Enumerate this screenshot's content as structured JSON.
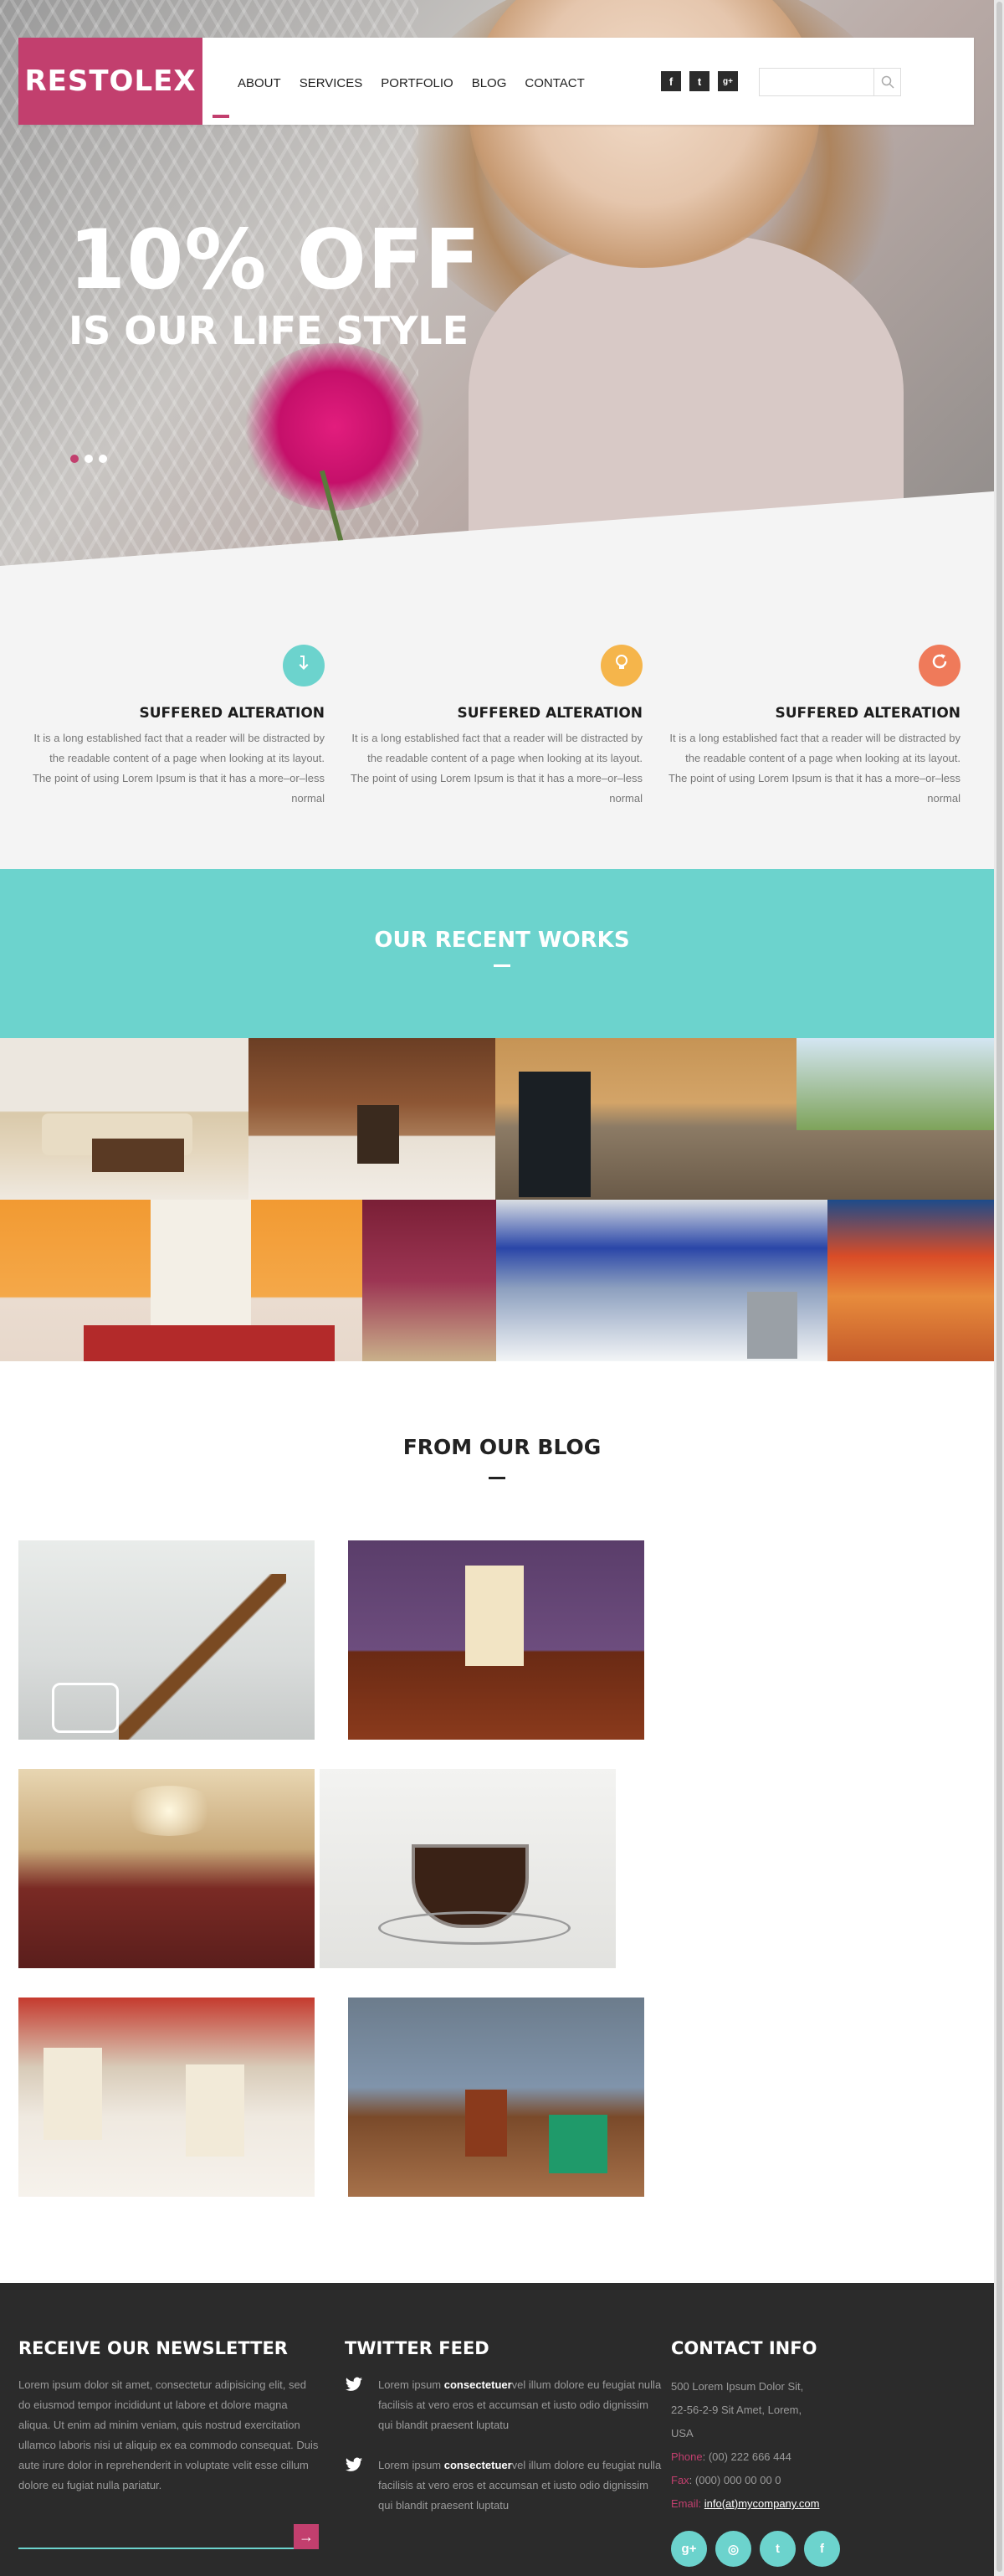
{
  "header": {
    "logo": "RESTOLEX",
    "nav": [
      "ABOUT",
      "SERVICES",
      "PORTFOLIO",
      "BLOG",
      "CONTACT"
    ],
    "social": [
      {
        "icon": "facebook-icon",
        "glyph": "f"
      },
      {
        "icon": "twitter-icon",
        "glyph": "t"
      },
      {
        "icon": "google-plus-icon",
        "glyph": "g+"
      }
    ],
    "search": {
      "placeholder": "",
      "icon": "search-icon"
    }
  },
  "hero": {
    "headline": "10% OFF",
    "subheadline": "IS OUR LIFE STYLE",
    "slides": 3,
    "active_slide": 1
  },
  "features": [
    {
      "icon": "arrow-down-icon",
      "color": "#6cd3cd",
      "title": "SUFFERED ALTERATION",
      "text": "It is a long established fact that a reader will be distracted by the readable content of a page when looking at its layout. The point of using Lorem Ipsum is that it has a more–or–less normal"
    },
    {
      "icon": "lightbulb-icon",
      "color": "#f5b54b",
      "title": "SUFFERED ALTERATION",
      "text": "It is a long established fact that a reader will be distracted by the readable content of a page when looking at its layout. The point of using Lorem Ipsum is that it has a more–or–less normal"
    },
    {
      "icon": "refresh-icon",
      "color": "#ef7a5a",
      "title": "SUFFERED ALTERATION",
      "text": "It is a long established fact that a reader will be distracted by the readable content of a page when looking at its layout. The point of using Lorem Ipsum is that it has a more–or–less normal"
    }
  ],
  "works": {
    "title": "OUR RECENT WORKS"
  },
  "blog": {
    "title": "FROM OUR BLOG"
  },
  "footer": {
    "newsletter": {
      "title": "RECEIVE OUR NEWSLETTER",
      "text": "Lorem ipsum dolor sit amet, consectetur adipisicing elit, sed do eiusmod tempor incididunt ut labore et dolore magna aliqua. Ut enim ad minim veniam, quis nostrud exercitation ullamco laboris nisi ut aliquip ex ea commodo consequat. Duis aute irure dolor in reprehenderit in voluptate velit esse cillum dolore eu fugiat nulla pariatur."
    },
    "twitter": {
      "title": "TWITTER FEED",
      "tweets": [
        {
          "pre": "Lorem ipsum ",
          "bold": "consectetuer",
          "post": "vel illum dolore eu feugiat nulla facilisis at vero eros et accumsan et iusto odio dignissim qui blandit praesent luptatu"
        },
        {
          "pre": "Lorem ipsum ",
          "bold": "consectetuer",
          "post": "vel illum dolore eu feugiat nulla facilisis at vero eros et accumsan et iusto odio dignissim qui blandit praesent luptatu"
        }
      ]
    },
    "contact": {
      "title": "CONTACT INFO",
      "address": [
        "500 Lorem Ipsum Dolor Sit,",
        "22-56-2-9 Sit Amet, Lorem,",
        "USA"
      ],
      "phone_label": "Phone",
      "phone": ": (00) 222 666 444",
      "fax_label": "Fax",
      "fax": ": (000) 000 00 00 0",
      "email_label": "Email",
      "email_sep": ": ",
      "email": "info(at)mycompany.com",
      "social": [
        {
          "icon": "google-plus-icon",
          "glyph": "g+"
        },
        {
          "icon": "dribbble-icon",
          "glyph": "◎"
        },
        {
          "icon": "twitter-icon",
          "glyph": "t"
        },
        {
          "icon": "facebook-icon",
          "glyph": "f"
        }
      ]
    }
  },
  "colors": {
    "accent": "#c23f6e",
    "teal": "#6cd3cd",
    "footer_bg": "#2b2b2b"
  }
}
